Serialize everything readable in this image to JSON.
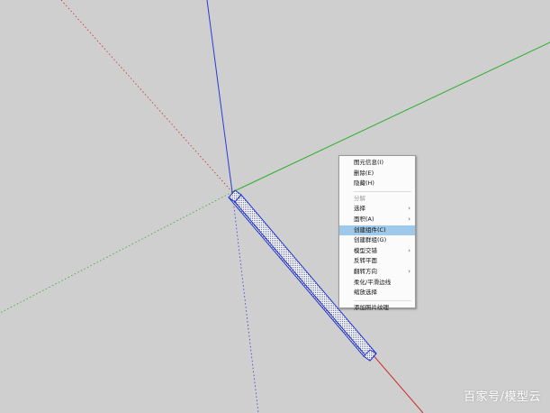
{
  "canvas": {
    "background": "#cfcfcf"
  },
  "axes": {
    "blue_axis_color": "#2b3bd6",
    "green_axis_color": "#2fae2f",
    "red_axis_color": "#cc2a2a"
  },
  "model": {
    "name": "selected-beam",
    "outline_color": "#2233cc"
  },
  "context_menu": {
    "items": [
      {
        "label": "图元信息(I)",
        "type": "item"
      },
      {
        "label": "删除(E)",
        "type": "item"
      },
      {
        "label": "隐藏(H)",
        "type": "item"
      },
      {
        "type": "separator"
      },
      {
        "label": "分解",
        "type": "item",
        "disabled": true
      },
      {
        "label": "选择",
        "type": "item",
        "submenu": true
      },
      {
        "label": "面积(A)",
        "type": "item",
        "submenu": true
      },
      {
        "label": "创建组件(C)",
        "type": "item",
        "highlighted": true
      },
      {
        "label": "创建群组(G)",
        "type": "item"
      },
      {
        "label": "模型交错",
        "type": "item",
        "submenu": true
      },
      {
        "label": "反转平面",
        "type": "item"
      },
      {
        "label": "翻转方向",
        "type": "item",
        "submenu": true
      },
      {
        "label": "柔化/平滑边线",
        "type": "item"
      },
      {
        "label": "缩放选择",
        "type": "item"
      },
      {
        "type": "separator"
      },
      {
        "label": "添加照片纹理",
        "type": "item"
      }
    ],
    "submenu_arrow_icon": "chevron-right-icon"
  },
  "watermark": {
    "text": "百家号/模型云"
  }
}
